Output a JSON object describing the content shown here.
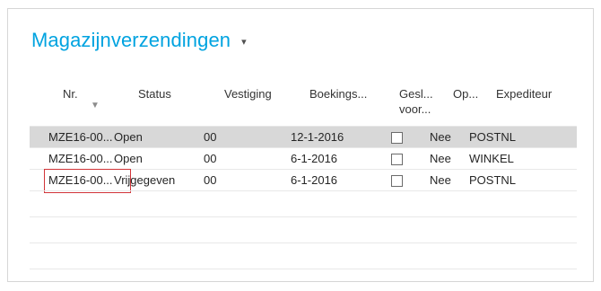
{
  "page": {
    "title": "Magazijnverzendingen",
    "title_caret": "▾"
  },
  "columns": {
    "nr": "Nr.",
    "status": "Status",
    "vestiging": "Vestiging",
    "boekingsdatum": "Boekings...",
    "gesloten_line1": "Gesl...",
    "gesloten_line2": "voor...",
    "op": "Op...",
    "expediteur": "Expediteur"
  },
  "sort_icon": "sort-descending-icon",
  "rows": [
    {
      "nr": "MZE16-00...",
      "status": "Open",
      "vestiging": "00",
      "datum": "12-1-2016",
      "gesloten": false,
      "op": "Nee",
      "expediteur": "POSTNL",
      "selected": true
    },
    {
      "nr": "MZE16-00...",
      "status": "Open",
      "vestiging": "00",
      "datum": "6-1-2016",
      "gesloten": false,
      "op": "Nee",
      "expediteur": "WINKEL",
      "selected": false
    },
    {
      "nr": "MZE16-00...",
      "status": "Vrijgegeven",
      "vestiging": "00",
      "datum": "6-1-2016",
      "gesloten": false,
      "op": "Nee",
      "expediteur": "POSTNL",
      "selected": false,
      "focused": true
    }
  ],
  "colors": {
    "accent": "#00a3e0",
    "selected_row": "#d8d8d8",
    "focus_border": "#d13438"
  }
}
